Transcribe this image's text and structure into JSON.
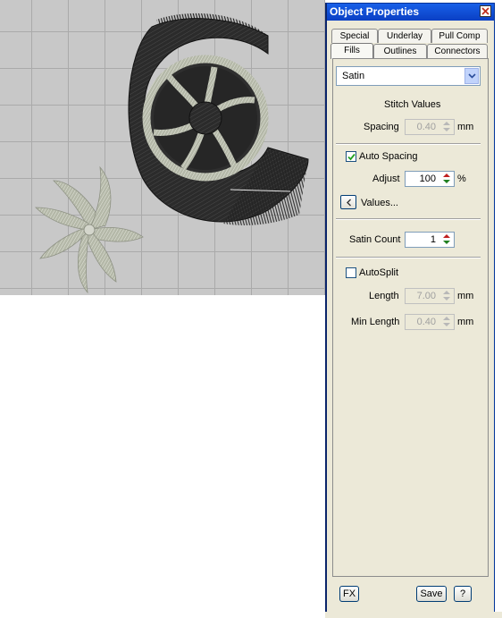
{
  "panel": {
    "title": "Object Properties",
    "tabs_row1": [
      "Special",
      "Underlay",
      "Pull Comp"
    ],
    "tabs_row2": [
      "Fills",
      "Outlines",
      "Connectors"
    ],
    "active_tab": "Fills"
  },
  "fill": {
    "type_selected": "Satin",
    "stitch_values_heading": "Stitch Values",
    "spacing_label": "Spacing",
    "spacing_value": "0.40",
    "spacing_unit": "mm",
    "auto_spacing_label": "Auto Spacing",
    "auto_spacing_checked": true,
    "adjust_label": "Adjust",
    "adjust_value": "100",
    "adjust_unit": "%",
    "values_label": "Values...",
    "satin_count_label": "Satin Count",
    "satin_count_value": "1",
    "autosplit_label": "AutoSplit",
    "autosplit_checked": false,
    "length_label": "Length",
    "length_value": "7.00",
    "length_unit": "mm",
    "min_length_label": "Min Length",
    "min_length_value": "0.40",
    "min_length_unit": "mm"
  },
  "footer": {
    "fx_label": "FX",
    "save_label": "Save",
    "help_label": "?"
  },
  "icons": {
    "close": "close-icon",
    "dropdown": "chevron-down-icon",
    "values": "chevron-left-icon",
    "check": "checkmark-icon"
  },
  "colors": {
    "titlebar": "#0a3fc4",
    "panel_bg": "#ece9d8",
    "canvas_bg": "#c8c8c8",
    "embroidery_dark": "#2a2a2a",
    "embroidery_light": "#b8bcae"
  }
}
